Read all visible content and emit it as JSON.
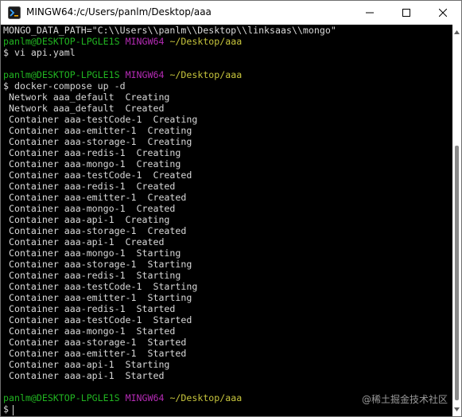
{
  "window": {
    "title": "MINGW64:/c/Users/panlm/Desktop/aaa"
  },
  "terminal": {
    "env_line": "MONGO_DATA_PATH=\"C:\\\\Users\\\\panlm\\\\Desktop\\\\linksaas\\\\mongo\"",
    "prompts": [
      {
        "user": "panlm@DESKTOP-LPGLE1S",
        "system": "MINGW64",
        "path": "~/Desktop/aaa",
        "command": "$ vi api.yaml"
      },
      {
        "user": "panlm@DESKTOP-LPGLE1S",
        "system": "MINGW64",
        "path": "~/Desktop/aaa",
        "command": "$ docker-compose up -d"
      },
      {
        "user": "panlm@DESKTOP-LPGLE1S",
        "system": "MINGW64",
        "path": "~/Desktop/aaa",
        "command": "$"
      }
    ],
    "output_lines": [
      " Network aaa_default  Creating",
      " Network aaa_default  Created",
      " Container aaa-testCode-1  Creating",
      " Container aaa-emitter-1  Creating",
      " Container aaa-storage-1  Creating",
      " Container aaa-redis-1  Creating",
      " Container aaa-mongo-1  Creating",
      " Container aaa-testCode-1  Created",
      " Container aaa-redis-1  Created",
      " Container aaa-emitter-1  Created",
      " Container aaa-mongo-1  Created",
      " Container aaa-api-1  Creating",
      " Container aaa-storage-1  Created",
      " Container aaa-api-1  Created",
      " Container aaa-mongo-1  Starting",
      " Container aaa-storage-1  Starting",
      " Container aaa-redis-1  Starting",
      " Container aaa-testCode-1  Starting",
      " Container aaa-emitter-1  Starting",
      " Container aaa-redis-1  Started",
      " Container aaa-testCode-1  Started",
      " Container aaa-mongo-1  Started",
      " Container aaa-storage-1  Started",
      " Container aaa-emitter-1  Started",
      " Container aaa-api-1  Starting",
      " Container aaa-api-1  Started"
    ]
  },
  "watermark": "@稀土掘金技术社区",
  "colors": {
    "background": "#000000",
    "text": "#d8d8d8",
    "user": "#21b521",
    "system": "#b52bb5",
    "path": "#c6c43c"
  },
  "icons": {
    "app": "mingw-terminal-icon",
    "minimize": "minimize-icon",
    "maximize": "maximize-icon",
    "close": "close-icon"
  }
}
